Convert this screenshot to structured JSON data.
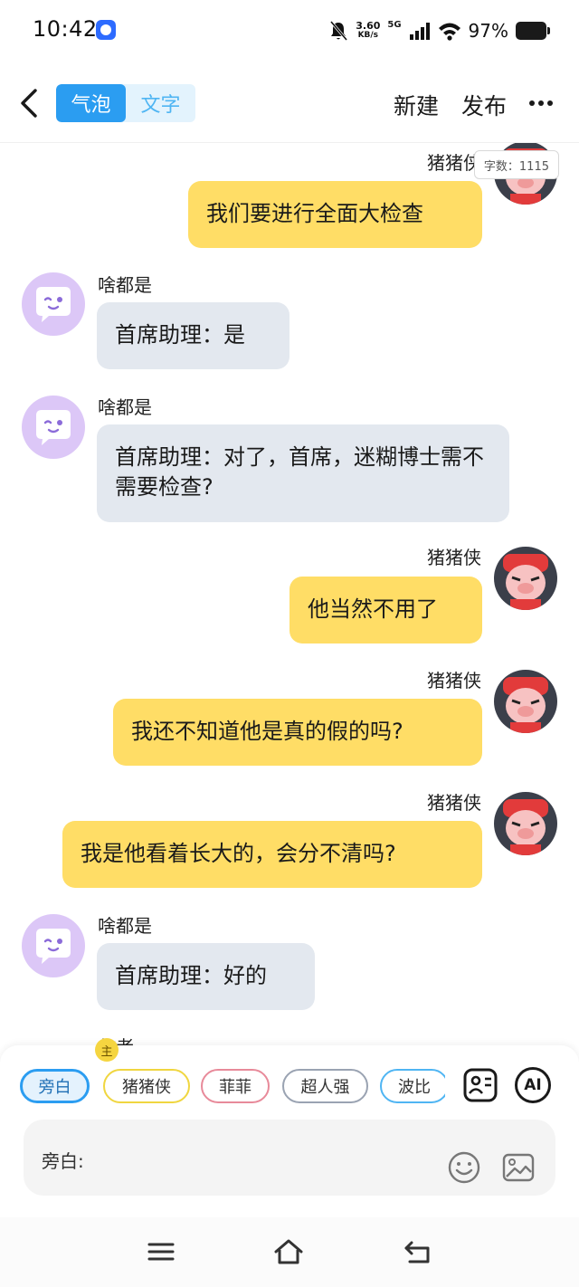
{
  "status": {
    "time": "10:42",
    "speed_value": "3.60",
    "speed_unit": "KB/s",
    "network": "5G",
    "battery": "97%"
  },
  "header": {
    "tab_bubble": "气泡",
    "tab_text": "文字",
    "new_label": "新建",
    "publish_label": "发布",
    "icons": [
      "back-icon",
      "more-icon"
    ]
  },
  "char_count": "字数：1115",
  "messages": [
    {
      "side": "right",
      "name": "猪猪侠",
      "text": "我们要进行全面大检查"
    },
    {
      "side": "left",
      "name": "啥都是",
      "text": "首席助理：是"
    },
    {
      "side": "left",
      "name": "啥都是",
      "text": "首席助理：对了，首席，迷糊博士需不需要检查?"
    },
    {
      "side": "right",
      "name": "猪猪侠",
      "text": "他当然不用了"
    },
    {
      "side": "right",
      "name": "猪猪侠",
      "text": "我还不知道他是真的假的吗?"
    },
    {
      "side": "right",
      "name": "猪猪侠",
      "text": "我是他看着长大的，会分不清吗?"
    },
    {
      "side": "left",
      "name": "啥都是",
      "text": "首席助理：好的"
    },
    {
      "side": "left",
      "name": "作者",
      "text": ""
    }
  ],
  "roles": {
    "narration": "旁白",
    "badge": "主",
    "pig": "猪猪侠",
    "feifei": "菲菲",
    "superman": "超人强",
    "bobi": "波比",
    "ai_label": "AI"
  },
  "input": {
    "label": "旁白:"
  },
  "colors": {
    "accent": "#2b9df1",
    "bubble_right": "#ffdd66",
    "bubble_left": "#e3e8ef",
    "narrator_avatar": "#dcc7f7"
  }
}
